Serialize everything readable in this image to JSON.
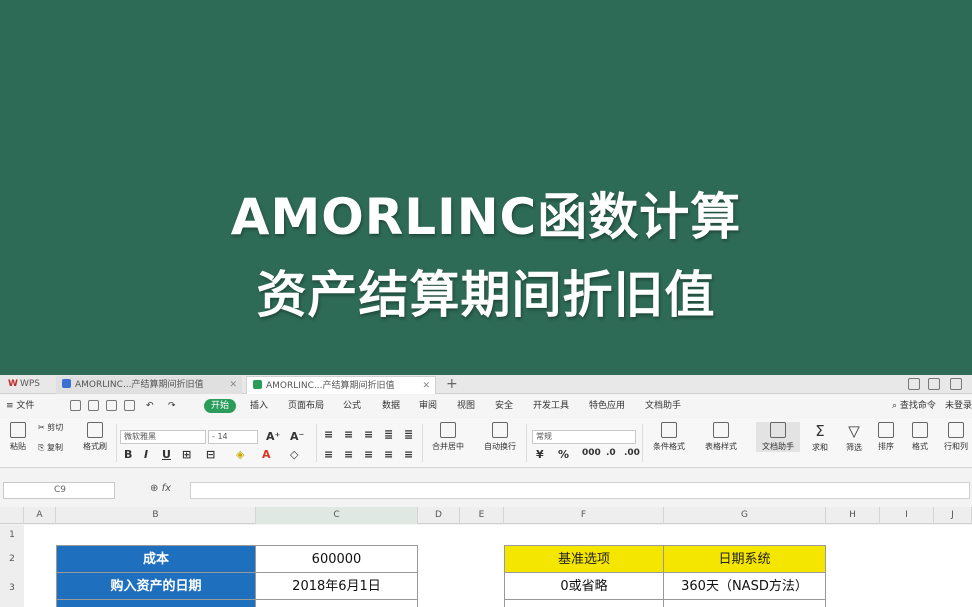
{
  "banner": {
    "title_line1": "AMORLINC函数计算",
    "title_line2": "资产结算期间折旧值",
    "bg_color": "#2e6b57"
  },
  "tabs": {
    "app_name": "WPS",
    "doc_tab_a": "AMORLINC...产结算期间折旧值",
    "doc_tab_b": "AMORLINC...产结算期间折旧值"
  },
  "menu": {
    "file": "文件",
    "start": "开始",
    "insert": "插入",
    "page_layout": "页面布局",
    "formula": "公式",
    "data": "数据",
    "review": "审阅",
    "view": "视图",
    "security": "安全",
    "dev_tools": "开发工具",
    "special_apps": "特色应用",
    "doc_assistant": "文档助手",
    "search": "查找命令",
    "account": "未登录"
  },
  "toolbar": {
    "paste": "粘贴",
    "cut": "剪切",
    "copy": "复制",
    "format_painter": "格式刷",
    "font_name": "微软雅黑",
    "font_size": "14",
    "merge_center": "合并居中",
    "wrap_text": "自动换行",
    "number_format": "常规",
    "cond_format": "条件格式",
    "table_style": "表格样式",
    "doc_assist": "文档助手",
    "sum": "求和",
    "filter": "筛选",
    "sort": "排序",
    "format": "格式",
    "rows_cols": "行和列"
  },
  "formula_bar": {
    "cell_ref": "C9",
    "fx": "fx"
  },
  "columns": [
    "A",
    "B",
    "C",
    "D",
    "E",
    "F",
    "G",
    "H",
    "I",
    "J"
  ],
  "rows": [
    "1",
    "2",
    "3"
  ],
  "table_left": [
    {
      "label": "成本",
      "value": "600000"
    },
    {
      "label": "购入资产的日期",
      "value": "2018年6月1日"
    }
  ],
  "table_right": {
    "headers": [
      "基准选项",
      "日期系统"
    ],
    "row1": [
      "0或省略",
      "360天（NASD方法）"
    ]
  },
  "colors": {
    "blue_header": "#1f6fbf",
    "yellow_header": "#f5e600",
    "start_tab": "#2a9d5b"
  }
}
